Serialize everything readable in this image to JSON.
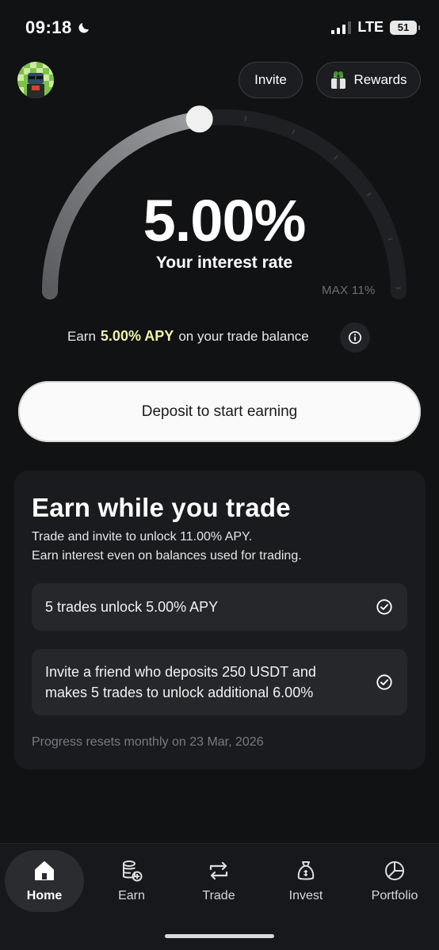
{
  "status_bar": {
    "time": "09:18",
    "network": "LTE",
    "battery": "51"
  },
  "header": {
    "invite_label": "Invite",
    "rewards_label": "Rewards"
  },
  "gauge": {
    "rate": "5.00%",
    "label": "Your interest rate",
    "max_label": "MAX 11%",
    "fill_fraction": 0.4545
  },
  "earn_line": {
    "prefix": "Earn",
    "highlight": "5.00% APY",
    "suffix": "on your trade balance"
  },
  "deposit_label": "Deposit to start earning",
  "card": {
    "title": "Earn while you trade",
    "subtitle_line1": "Trade and invite to unlock 11.00% APY.",
    "subtitle_line2": "Earn interest even on balances used for trading.",
    "tasks": [
      {
        "label": "5 trades unlock 5.00% APY"
      },
      {
        "label": "Invite a friend who deposits 250 USDT and makes 5 trades to unlock additional 6.00%"
      }
    ],
    "footer": "Progress resets monthly on 23 Mar, 2026"
  },
  "nav": {
    "items": [
      {
        "label": "Home",
        "icon": "home-icon"
      },
      {
        "label": "Earn",
        "icon": "coins-plus-icon"
      },
      {
        "label": "Trade",
        "icon": "swap-arrows-icon"
      },
      {
        "label": "Invest",
        "icon": "money-bag-icon"
      },
      {
        "label": "Portfolio",
        "icon": "pie-chart-icon"
      }
    ]
  },
  "colors": {
    "background": "#111214",
    "highlight": "#eef3a8",
    "card": "#1a1b1e"
  }
}
